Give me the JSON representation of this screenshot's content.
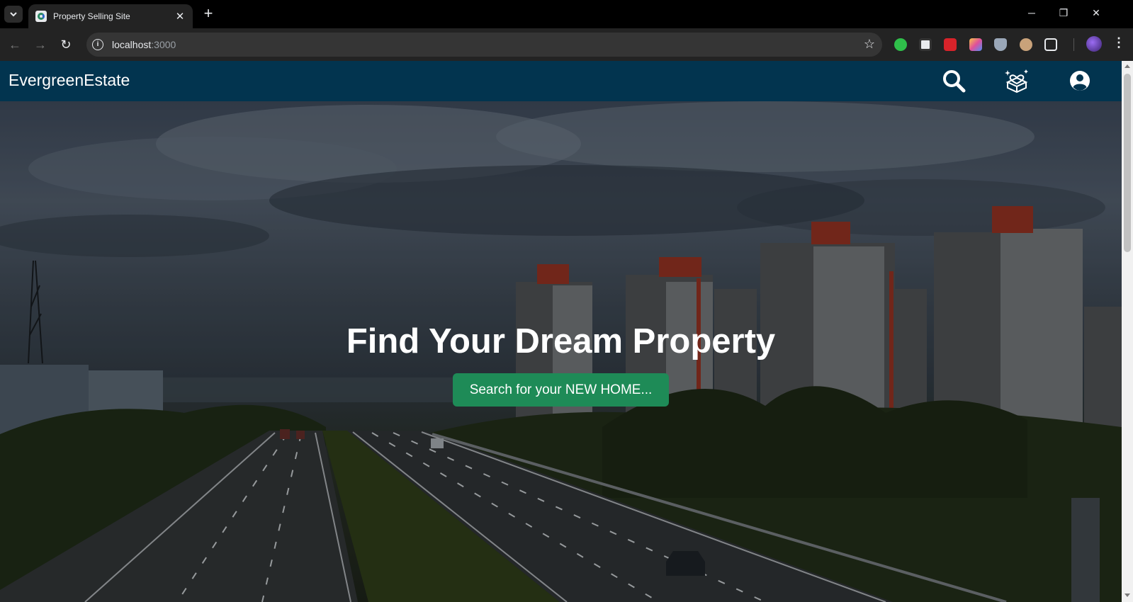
{
  "browser": {
    "tab_title": "Property Selling Site",
    "url_host": "localhost",
    "url_port": ":3000",
    "new_tab_label": "+",
    "tab_close_label": "✕",
    "window_controls": {
      "minimize": "─",
      "restore": "❐",
      "close": "✕"
    }
  },
  "site": {
    "brand": "EvergreenEstate",
    "nav_icons": [
      "search-icon",
      "wishlist-gift-icon",
      "account-icon"
    ],
    "colors": {
      "navbar": "#02344f",
      "cta": "#1e8b57"
    }
  },
  "hero": {
    "title": "Find Your Dream Property",
    "button_label": "Search for your NEW HOME..."
  }
}
